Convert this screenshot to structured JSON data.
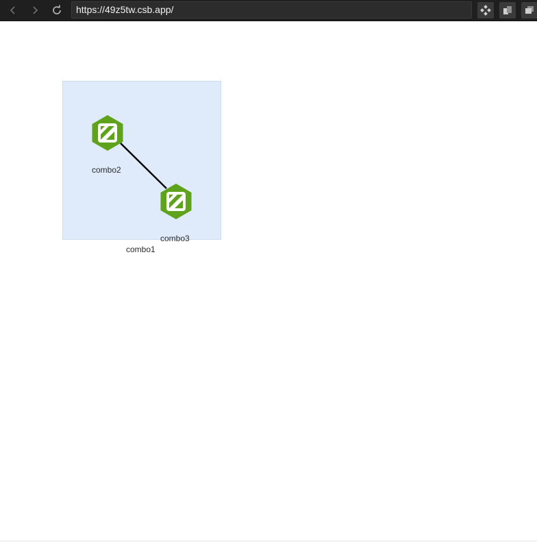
{
  "browser": {
    "url": "https://49z5tw.csb.app/",
    "back_icon": "chevron-left-icon",
    "forward_icon": "chevron-right-icon",
    "reload_icon": "reload-icon"
  },
  "graph": {
    "combos": [
      {
        "id": "combo1",
        "label": "combo1"
      },
      {
        "id": "combo2",
        "label": "combo2"
      },
      {
        "id": "combo3",
        "label": "combo3"
      }
    ],
    "edges": [
      {
        "source": "combo2",
        "target": "combo3"
      }
    ],
    "colors": {
      "combo_fill": "#dfeafb",
      "combo_stroke": "#cfdcef",
      "node_fill": "#5fa21b",
      "edge_stroke": "#000000"
    }
  }
}
